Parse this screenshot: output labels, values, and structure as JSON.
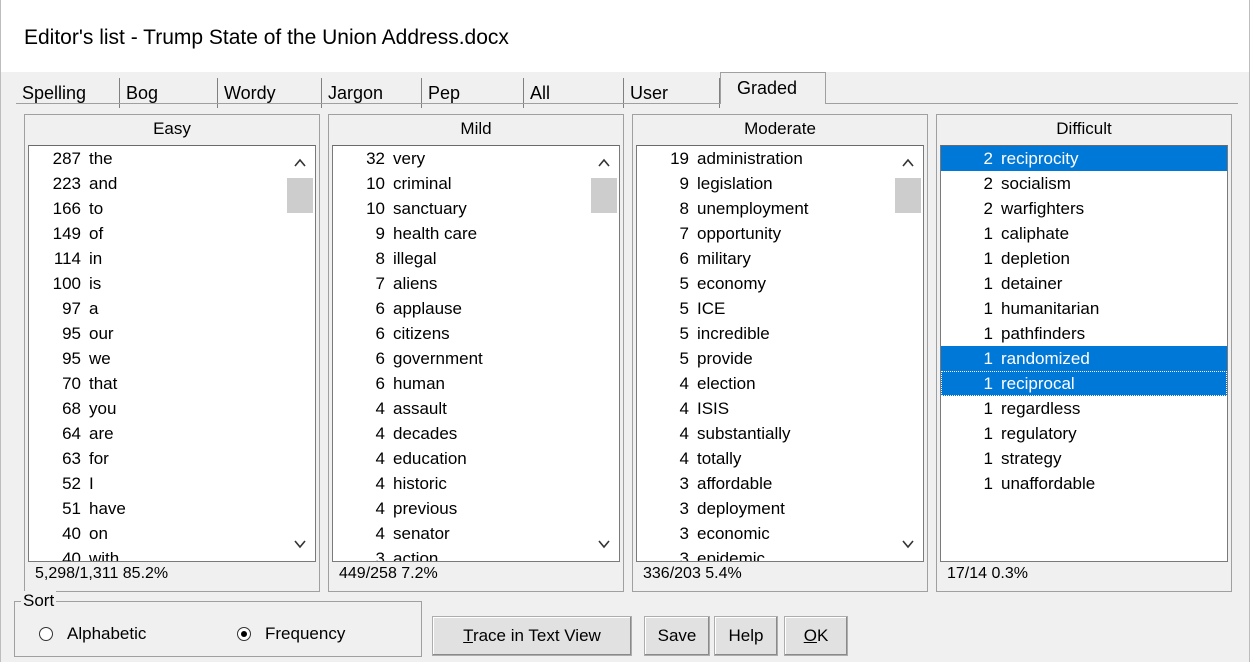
{
  "window": {
    "title": "Editor's list - Trump State of the Union Address.docx"
  },
  "tabs": [
    "Spelling",
    "Bog",
    "Wordy",
    "Jargon",
    "Pep",
    "All",
    "User",
    "Graded"
  ],
  "active_tab": "Graded",
  "panels": {
    "easy": {
      "header": "Easy",
      "footer": "5,298/1,311   85.2%",
      "rows": [
        {
          "count": "287",
          "word": "the"
        },
        {
          "count": "223",
          "word": "and"
        },
        {
          "count": "166",
          "word": "to"
        },
        {
          "count": "149",
          "word": "of"
        },
        {
          "count": "114",
          "word": "in"
        },
        {
          "count": "100",
          "word": "is"
        },
        {
          "count": "97",
          "word": "a"
        },
        {
          "count": "95",
          "word": "our"
        },
        {
          "count": "95",
          "word": "we"
        },
        {
          "count": "70",
          "word": "that"
        },
        {
          "count": "68",
          "word": "you"
        },
        {
          "count": "64",
          "word": "are"
        },
        {
          "count": "63",
          "word": "for"
        },
        {
          "count": "52",
          "word": "I"
        },
        {
          "count": "51",
          "word": "have"
        },
        {
          "count": "40",
          "word": "on"
        },
        {
          "count": "40",
          "word": "with"
        }
      ]
    },
    "mild": {
      "header": "Mild",
      "footer": "449/258   7.2%",
      "rows": [
        {
          "count": "32",
          "word": "very"
        },
        {
          "count": "10",
          "word": "criminal"
        },
        {
          "count": "10",
          "word": "sanctuary"
        },
        {
          "count": "9",
          "word": "health care"
        },
        {
          "count": "8",
          "word": "illegal"
        },
        {
          "count": "7",
          "word": "aliens"
        },
        {
          "count": "6",
          "word": "applause"
        },
        {
          "count": "6",
          "word": "citizens"
        },
        {
          "count": "6",
          "word": "government"
        },
        {
          "count": "6",
          "word": "human"
        },
        {
          "count": "4",
          "word": "assault"
        },
        {
          "count": "4",
          "word": "decades"
        },
        {
          "count": "4",
          "word": "education"
        },
        {
          "count": "4",
          "word": "historic"
        },
        {
          "count": "4",
          "word": "previous"
        },
        {
          "count": "4",
          "word": "senator"
        },
        {
          "count": "3",
          "word": "action"
        }
      ]
    },
    "moderate": {
      "header": "Moderate",
      "footer": "336/203   5.4%",
      "rows": [
        {
          "count": "19",
          "word": "administration"
        },
        {
          "count": "9",
          "word": "legislation"
        },
        {
          "count": "8",
          "word": "unemployment"
        },
        {
          "count": "7",
          "word": "opportunity"
        },
        {
          "count": "6",
          "word": "military"
        },
        {
          "count": "5",
          "word": "economy"
        },
        {
          "count": "5",
          "word": "ICE"
        },
        {
          "count": "5",
          "word": "incredible"
        },
        {
          "count": "5",
          "word": "provide"
        },
        {
          "count": "4",
          "word": "election"
        },
        {
          "count": "4",
          "word": "ISIS"
        },
        {
          "count": "4",
          "word": "substantially"
        },
        {
          "count": "4",
          "word": "totally"
        },
        {
          "count": "3",
          "word": "affordable"
        },
        {
          "count": "3",
          "word": "deployment"
        },
        {
          "count": "3",
          "word": "economic"
        },
        {
          "count": "3",
          "word": "epidemic"
        }
      ]
    },
    "difficult": {
      "header": "Difficult",
      "footer": "17/14   0.3%",
      "rows": [
        {
          "count": "2",
          "word": "reciprocity",
          "selected": true
        },
        {
          "count": "2",
          "word": "socialism"
        },
        {
          "count": "2",
          "word": "warfighters"
        },
        {
          "count": "1",
          "word": "caliphate"
        },
        {
          "count": "1",
          "word": "depletion"
        },
        {
          "count": "1",
          "word": "detainer"
        },
        {
          "count": "1",
          "word": "humanitarian"
        },
        {
          "count": "1",
          "word": "pathfinders"
        },
        {
          "count": "1",
          "word": "randomized",
          "selected": true
        },
        {
          "count": "1",
          "word": "reciprocal",
          "selected": true,
          "focus": true
        },
        {
          "count": "1",
          "word": "regardless"
        },
        {
          "count": "1",
          "word": "regulatory"
        },
        {
          "count": "1",
          "word": "strategy"
        },
        {
          "count": "1",
          "word": "unaffordable"
        }
      ]
    }
  },
  "sort": {
    "legend": "Sort",
    "options": [
      "Alphabetic",
      "Frequency"
    ],
    "selected": "Frequency"
  },
  "buttons": {
    "trace": "Trace in Text View",
    "save": "Save",
    "help": "Help",
    "ok": "OK"
  },
  "colors": {
    "selection": "#0078d7",
    "dialog_bg": "#f0f0f0"
  },
  "icons": {
    "scroll_up": "chevron-up-icon",
    "scroll_down": "chevron-down-icon"
  }
}
